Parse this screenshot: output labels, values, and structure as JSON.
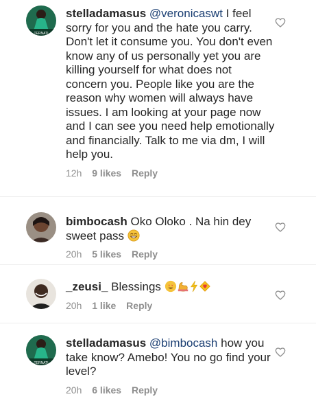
{
  "comments": [
    {
      "username": "stelladamasus",
      "mention": "@veronicaswt",
      "text": "I feel sorry for you and the hate you carry. Don't let it consume you. You don't even know any of us personally yet you are killing yourself for what does not concern you. People like you are the reason why women will always have issues. I am looking at your page now and I can see you need help emotionally and financially. Talk to me via dm, I will help you.",
      "time": "12h",
      "likes": "9 likes",
      "reply": "Reply",
      "icon": "heart-outline-icon"
    },
    {
      "username": "bimbocash",
      "mention": "",
      "text": "Oko Oloko . Na hin dey sweet pass",
      "emoji": "grinning-face-emoji",
      "time": "20h",
      "likes": "5 likes",
      "reply": "Reply",
      "icon": "heart-outline-icon"
    },
    {
      "username": "_zeusi_",
      "mention": "",
      "text": "Blessings",
      "emoji": "heart-eyes-face, muscle, lightning, sparkle-heart",
      "time": "20h",
      "likes": "1 like",
      "reply": "Reply",
      "icon": "heart-outline-icon"
    },
    {
      "username": "stelladamasus",
      "mention": "@bimbocash",
      "text": "how you take know? Amebo! You no go find your level?",
      "time": "20h",
      "likes": "6 likes",
      "reply": "Reply",
      "icon": "heart-outline-icon"
    }
  ],
  "colors": {
    "text": "#262626",
    "meta": "#8e8e8e",
    "mention": "#1a3e72",
    "divider": "#ececec"
  }
}
